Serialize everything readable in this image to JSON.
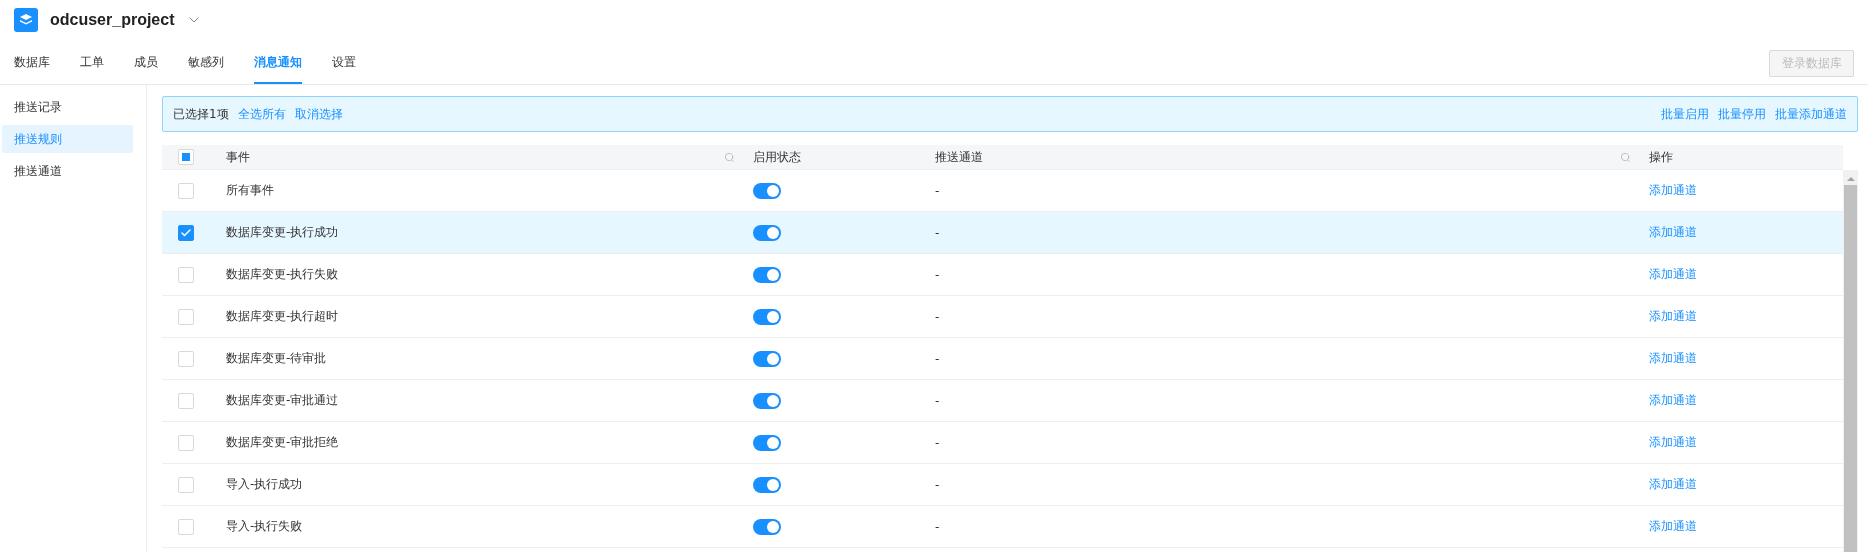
{
  "project": {
    "title": "odcuser_project"
  },
  "nav_tabs": [
    {
      "label": "数据库",
      "selected": false
    },
    {
      "label": "工单",
      "selected": false
    },
    {
      "label": "成员",
      "selected": false
    },
    {
      "label": "敏感列",
      "selected": false
    },
    {
      "label": "消息通知",
      "selected": true
    },
    {
      "label": "设置",
      "selected": false
    }
  ],
  "login_button": {
    "label": "登录数据库",
    "disabled": true
  },
  "sidebar": {
    "items": [
      {
        "label": "推送记录",
        "selected": false
      },
      {
        "label": "推送规则",
        "selected": true
      },
      {
        "label": "推送通道",
        "selected": false
      }
    ]
  },
  "selection_bar": {
    "summary": "已选择1项",
    "links": [
      "全选所有",
      "取消选择"
    ],
    "actions": [
      "批量启用",
      "批量停用",
      "批量添加通道"
    ]
  },
  "table": {
    "select_all": {
      "indeterminate": true
    },
    "columns": [
      {
        "label": "事件",
        "searchable": true
      },
      {
        "label": "启用状态",
        "searchable": false
      },
      {
        "label": "推送通道",
        "searchable": true
      },
      {
        "label": "操作",
        "searchable": false
      }
    ],
    "rows": [
      {
        "event": "所有事件",
        "enabled": true,
        "channel": "-",
        "action": "添加通道",
        "selected": false
      },
      {
        "event": "数据库变更-执行成功",
        "enabled": true,
        "channel": "-",
        "action": "添加通道",
        "selected": true
      },
      {
        "event": "数据库变更-执行失败",
        "enabled": true,
        "channel": "-",
        "action": "添加通道",
        "selected": false
      },
      {
        "event": "数据库变更-执行超时",
        "enabled": true,
        "channel": "-",
        "action": "添加通道",
        "selected": false
      },
      {
        "event": "数据库变更-待审批",
        "enabled": true,
        "channel": "-",
        "action": "添加通道",
        "selected": false
      },
      {
        "event": "数据库变更-审批通过",
        "enabled": true,
        "channel": "-",
        "action": "添加通道",
        "selected": false
      },
      {
        "event": "数据库变更-审批拒绝",
        "enabled": true,
        "channel": "-",
        "action": "添加通道",
        "selected": false
      },
      {
        "event": "导入-执行成功",
        "enabled": true,
        "channel": "-",
        "action": "添加通道",
        "selected": false
      },
      {
        "event": "导入-执行失败",
        "enabled": true,
        "channel": "-",
        "action": "添加通道",
        "selected": false
      }
    ]
  }
}
